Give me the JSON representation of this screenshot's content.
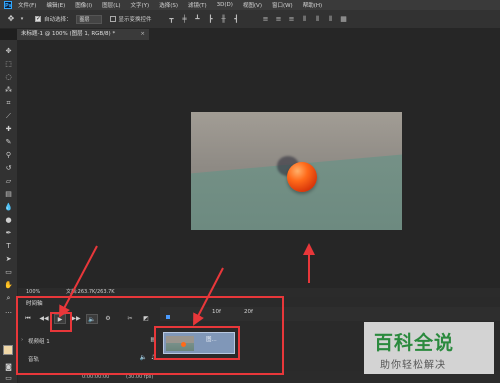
{
  "app": {
    "logo_text": "Ps",
    "accent_color": "#31a8ff"
  },
  "menu": [
    "文件(F)",
    "编辑(E)",
    "图像(I)",
    "图层(L)",
    "文字(Y)",
    "选择(S)",
    "滤镜(T)",
    "3D(D)",
    "视图(V)",
    "窗口(W)",
    "帮助(H)"
  ],
  "options_bar": {
    "auto_select_label": "自动选择：",
    "auto_select_value": "图层",
    "transform_controls_label": "显示变换控件"
  },
  "document_tab": {
    "title": "未标题-1 @ 100% (图层 1, RGB/8) *",
    "close_glyph": "×"
  },
  "status_bar": {
    "zoom": "100%",
    "doc_info": "文档:263.7K/263.7K"
  },
  "timeline": {
    "panel_title": "时间轴",
    "ruler_labels": [
      "10f",
      "20f"
    ],
    "tracks": [
      {
        "name": "视频组 1"
      },
      {
        "name": "音轨"
      }
    ],
    "clip_label": "图...",
    "time": "0:00:00:00",
    "fps": "(30.00 fps)"
  },
  "annotation_color": "#e8373a",
  "watermark": {
    "main": "百科全说",
    "sub": "助你轻松解决"
  }
}
